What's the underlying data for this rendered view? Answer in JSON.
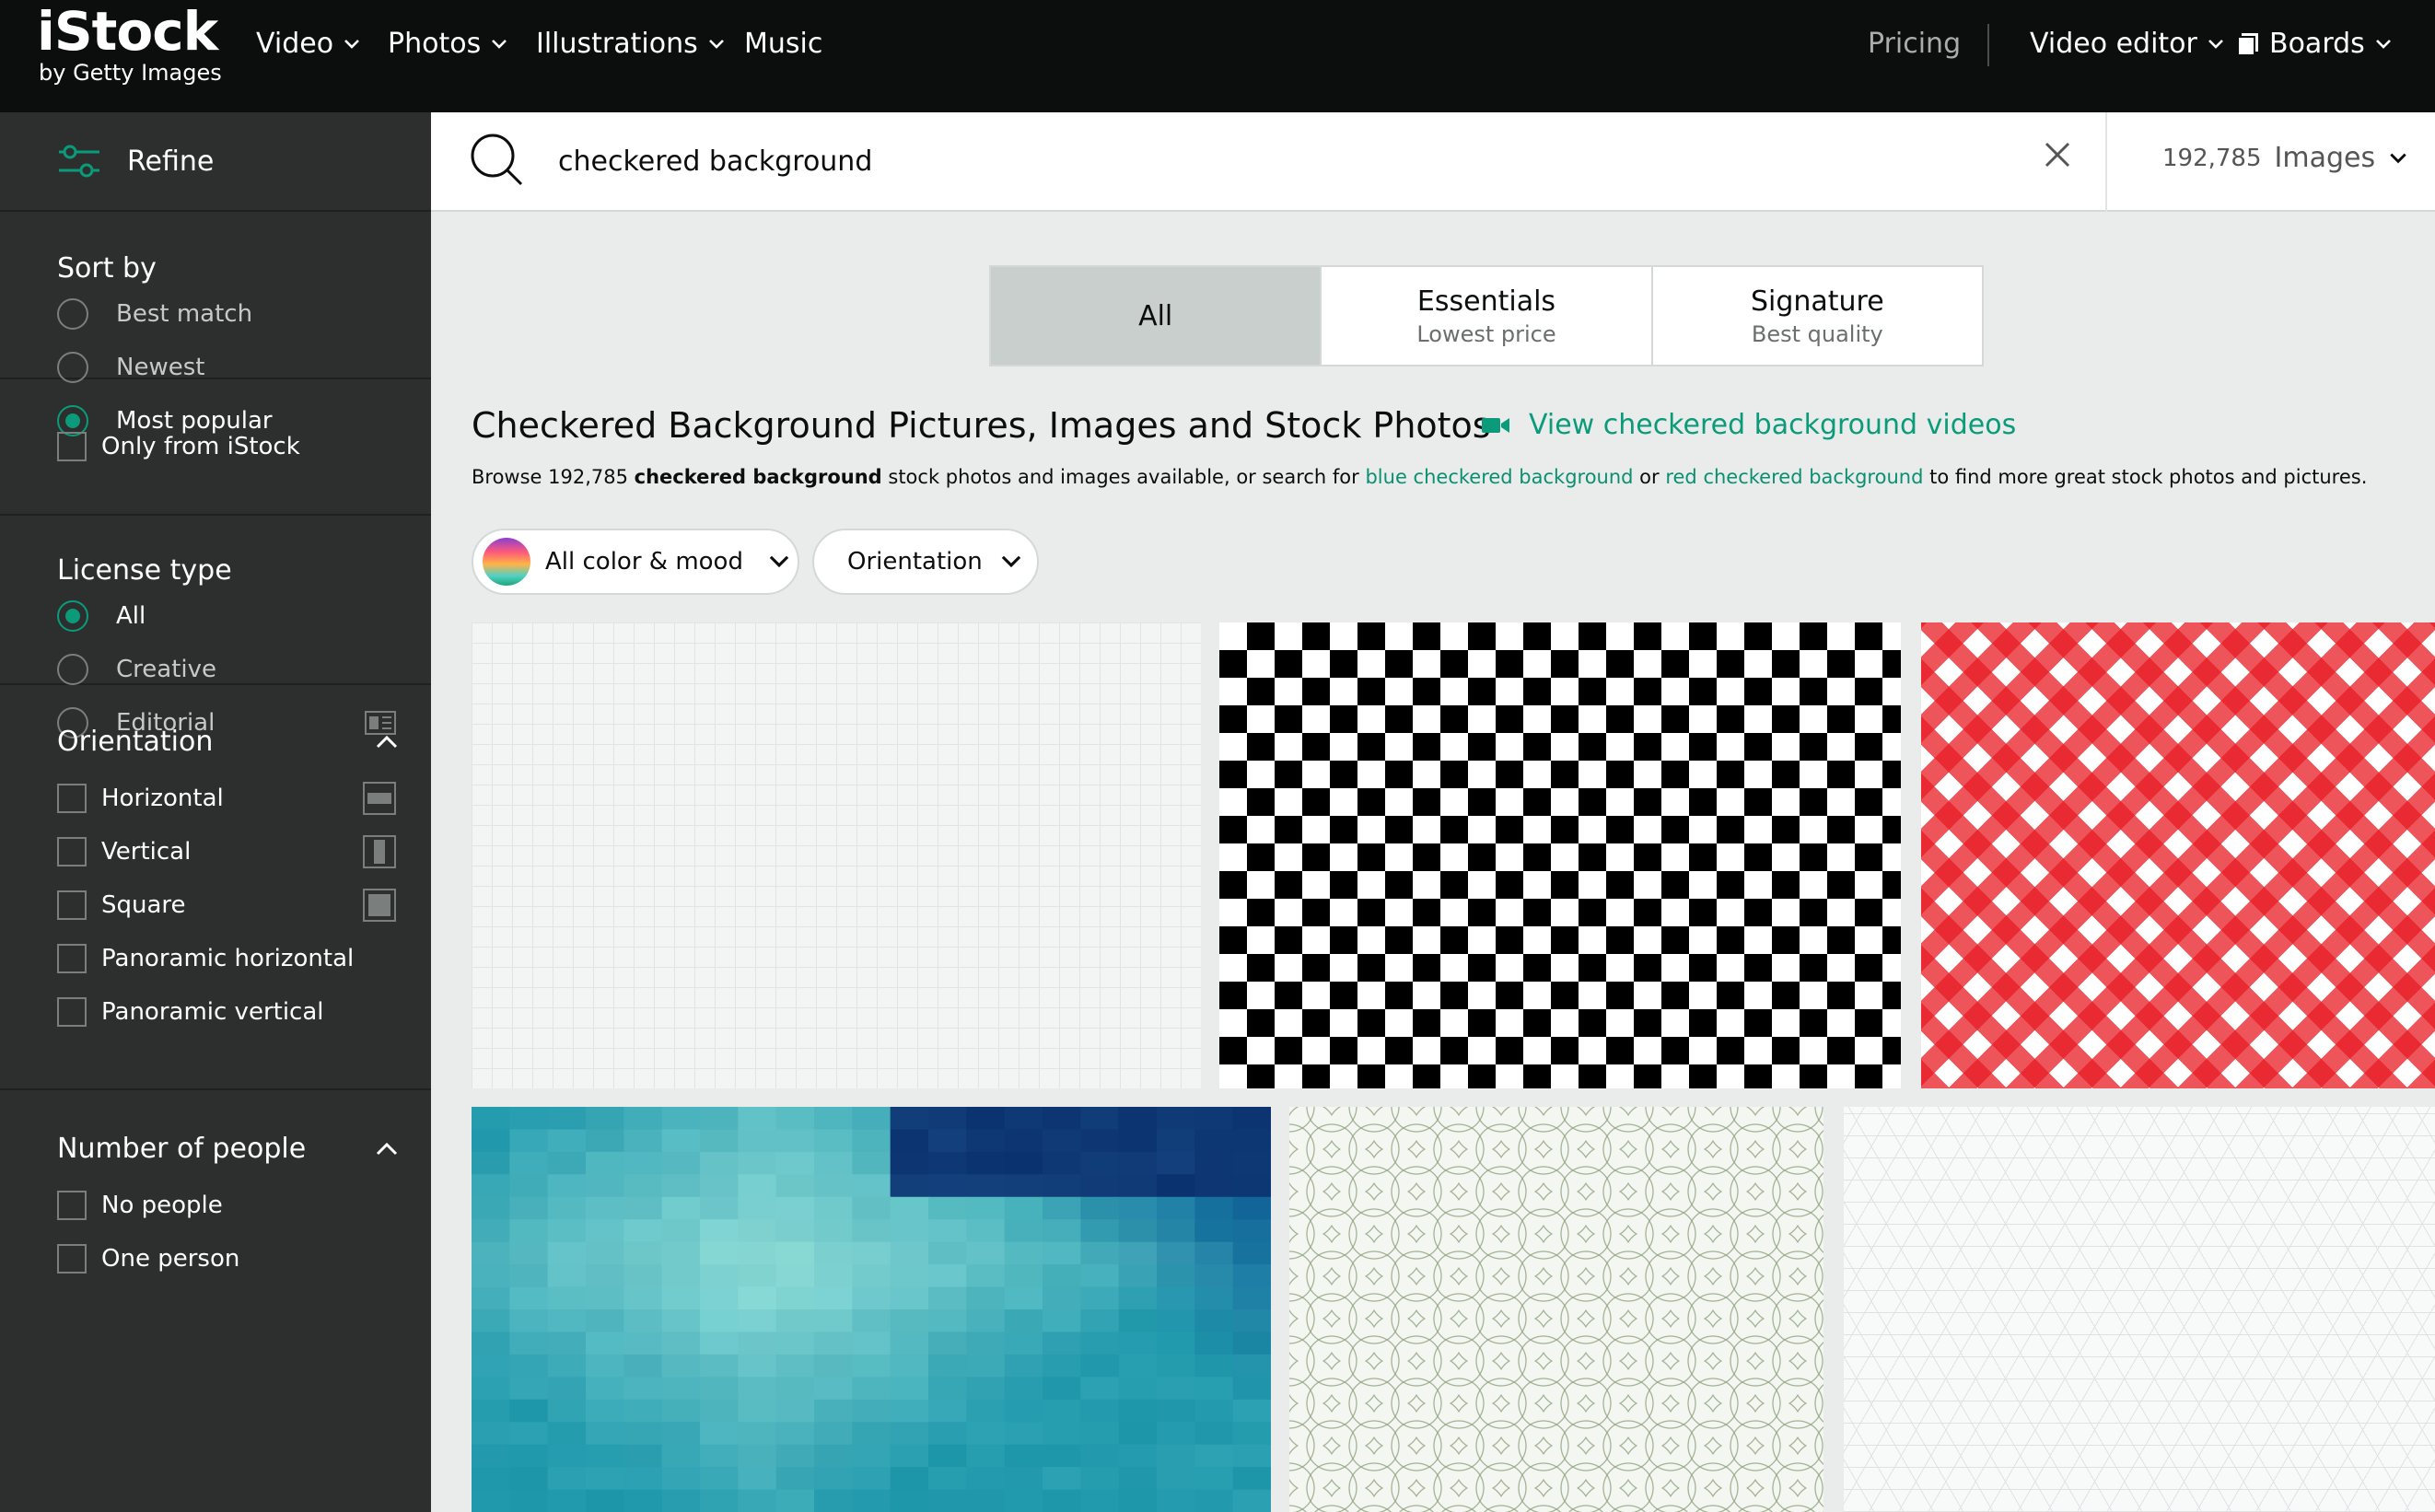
{
  "nav": {
    "logo_main": "iStock",
    "logo_sub": "by Getty Images",
    "items": [
      {
        "label": "Video"
      },
      {
        "label": "Photos"
      },
      {
        "label": "Illustrations"
      },
      {
        "label": "Music"
      }
    ],
    "pricing": "Pricing",
    "video_editor": "Video editor",
    "boards": "Boards"
  },
  "sidebar": {
    "refine": "Refine",
    "sort_by": {
      "title": "Sort by",
      "options": [
        "Best match",
        "Newest",
        "Most popular"
      ],
      "selected": "Most popular"
    },
    "only_istock": "Only from iStock",
    "license": {
      "title": "License type",
      "options": [
        "All",
        "Creative",
        "Editorial"
      ],
      "selected": "All"
    },
    "orientation": {
      "title": "Orientation",
      "options": [
        "Horizontal",
        "Vertical",
        "Square",
        "Panoramic horizontal",
        "Panoramic vertical"
      ]
    },
    "people": {
      "title": "Number of people",
      "options": [
        "No people",
        "One person"
      ]
    }
  },
  "search": {
    "query": "checkered background",
    "count": "192,785",
    "type": "Images"
  },
  "tabs": [
    {
      "title": "All",
      "sub": ""
    },
    {
      "title": "Essentials",
      "sub": "Lowest price"
    },
    {
      "title": "Signature",
      "sub": "Best quality"
    }
  ],
  "main": {
    "title": "Checkered Background Pictures, Images and Stock Photos",
    "video_link": "View checkered background videos",
    "desc": {
      "p1": "Browse 192,785 ",
      "bold": "checkered background",
      "p2": " stock photos and images available, or search for ",
      "link1": "blue checkered background",
      "p3": " or ",
      "link2": "red checkered background",
      "p4": " to find more great stock photos and pictures."
    },
    "filters": {
      "color": "All color & mood",
      "orientation": "Orientation"
    }
  },
  "colors": {
    "accent": "#0b9b7a",
    "nav_bg": "#0c0d0d",
    "sidebar_bg": "#2c2f2e",
    "checker_red": "#e81c24"
  }
}
